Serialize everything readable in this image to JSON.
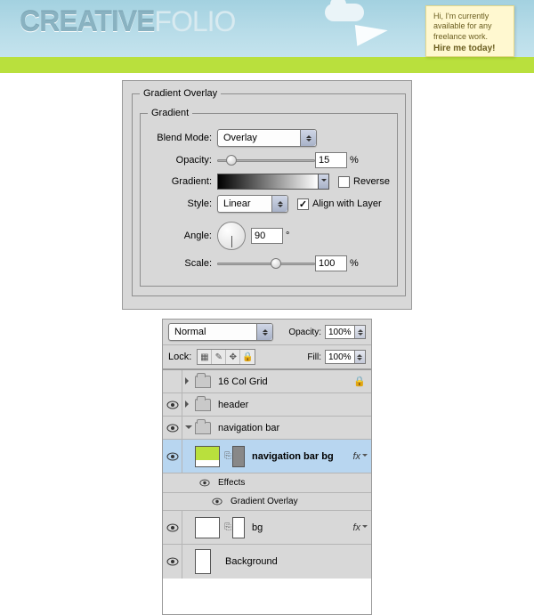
{
  "banner": {
    "logo_left": "CREATIVE",
    "logo_right": "FOLIO",
    "sticky_line": "Hi, I'm currently available for any freelance work.",
    "sticky_cta": "Hire me today!"
  },
  "gradient_panel": {
    "legend_outer": "Gradient Overlay",
    "legend_inner": "Gradient",
    "blend_label": "Blend Mode:",
    "blend_value": "Overlay",
    "opacity_label": "Opacity:",
    "opacity_value": "15",
    "pct": "%",
    "gradient_label": "Gradient:",
    "reverse_label": "Reverse",
    "style_label": "Style:",
    "style_value": "Linear",
    "align_label": "Align with Layer",
    "angle_label": "Angle:",
    "angle_value": "90",
    "deg": "°",
    "scale_label": "Scale:",
    "scale_value": "100"
  },
  "layers_panel": {
    "mode": "Normal",
    "opacity_label": "Opacity:",
    "opacity_value": "100%",
    "lock_label": "Lock:",
    "fill_label": "Fill:",
    "fill_value": "100%",
    "rows": {
      "grid": "16 Col Grid",
      "header": "header",
      "nav": "navigation bar",
      "nav_bg": "navigation bar bg",
      "effects": "Effects",
      "grad_ov": "Gradient Overlay",
      "bg": "bg",
      "background": "Background"
    },
    "fx": "fx"
  }
}
